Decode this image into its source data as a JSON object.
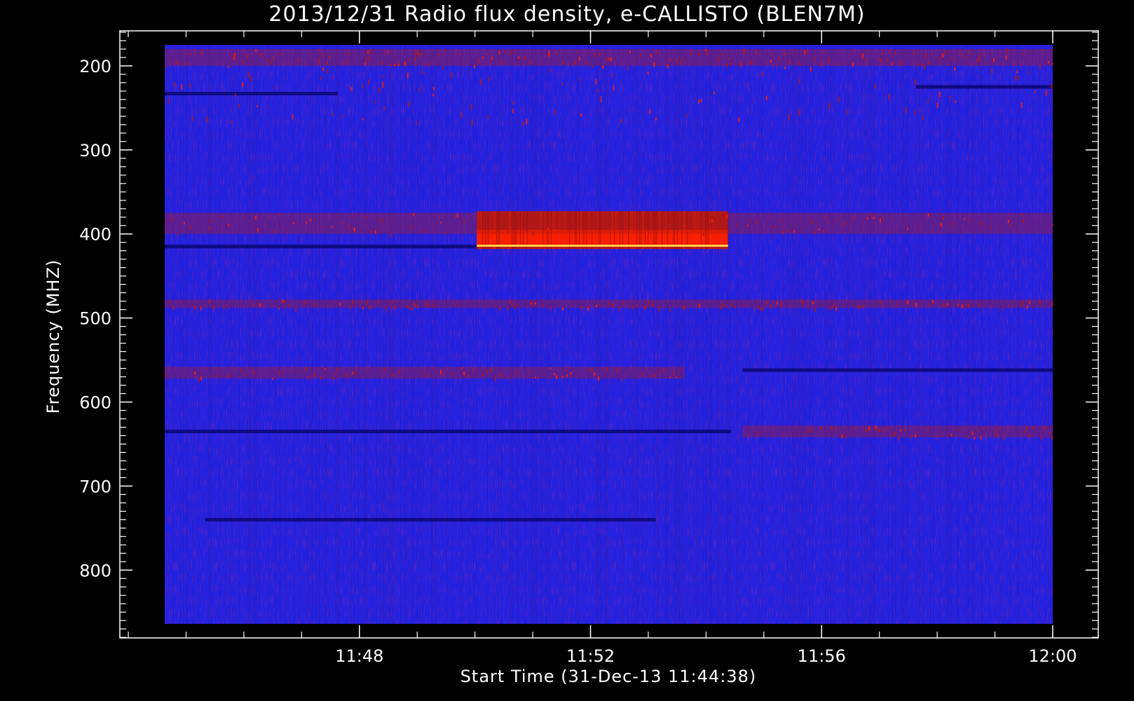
{
  "chart_data": {
    "type": "heatmap",
    "title": "2013/12/31  Radio flux density, e-CALLISTO (BLEN7M)",
    "xlabel": "Start Time (31-Dec-13 11:44:38)",
    "ylabel": "Frequency (MHZ)",
    "x_ticks": [
      "11:48",
      "11:52",
      "11:56",
      "12:00"
    ],
    "x_tick_values_min": [
      3.37,
      7.37,
      11.37,
      15.37
    ],
    "y_ticks": [
      200,
      300,
      400,
      500,
      600,
      700,
      800
    ],
    "xlim_min": [
      0,
      15.37
    ],
    "xlim_frame_min": [
      -0.75,
      16.13
    ],
    "ylim_mhz": [
      175,
      864
    ],
    "ylim_frame_mhz": [
      135,
      880
    ],
    "y_inverted": true,
    "colormap": {
      "background": "#2222e0",
      "dark_lane": "#050562",
      "warm": "#b01818",
      "hot": "#ff2000",
      "hottest": "#ffd050"
    },
    "features": [
      {
        "kind": "burst",
        "t_start_min": 5.4,
        "t_end_min": 9.75,
        "f_low_mhz": 373,
        "f_high_mhz": 418,
        "peak_mhz": 414,
        "level": "hot"
      },
      {
        "kind": "band",
        "t_start_min": 0,
        "t_end_min": 9.0,
        "f_low_mhz": 558,
        "f_high_mhz": 572,
        "level": "warm"
      },
      {
        "kind": "band",
        "t_start_min": 0,
        "t_end_min": 15.37,
        "f_low_mhz": 180,
        "f_high_mhz": 200,
        "level": "warm"
      },
      {
        "kind": "band",
        "t_start_min": 0,
        "t_end_min": 15.37,
        "f_low_mhz": 478,
        "f_high_mhz": 488,
        "level": "warm"
      },
      {
        "kind": "band",
        "t_start_min": 10.0,
        "t_end_min": 15.37,
        "f_low_mhz": 628,
        "f_high_mhz": 642,
        "level": "warm"
      },
      {
        "kind": "band",
        "t_start_min": 0,
        "t_end_min": 15.37,
        "f_low_mhz": 375,
        "f_high_mhz": 400,
        "level": "warm"
      },
      {
        "kind": "lane",
        "t_start_min": 0,
        "t_end_min": 5.4,
        "f_mhz": 415,
        "level": "dark_lane"
      },
      {
        "kind": "lane",
        "t_start_min": 0,
        "t_end_min": 9.8,
        "f_mhz": 635,
        "level": "dark_lane"
      },
      {
        "kind": "lane",
        "t_start_min": 0,
        "t_end_min": 3.0,
        "f_mhz": 233,
        "level": "dark_lane"
      },
      {
        "kind": "lane",
        "t_start_min": 13.0,
        "t_end_min": 15.37,
        "f_mhz": 225,
        "level": "dark_lane"
      },
      {
        "kind": "lane",
        "t_start_min": 0.7,
        "t_end_min": 8.5,
        "f_mhz": 740,
        "level": "dark_lane"
      },
      {
        "kind": "lane",
        "t_start_min": 10.0,
        "t_end_min": 15.37,
        "f_mhz": 562,
        "level": "dark_lane"
      }
    ]
  }
}
